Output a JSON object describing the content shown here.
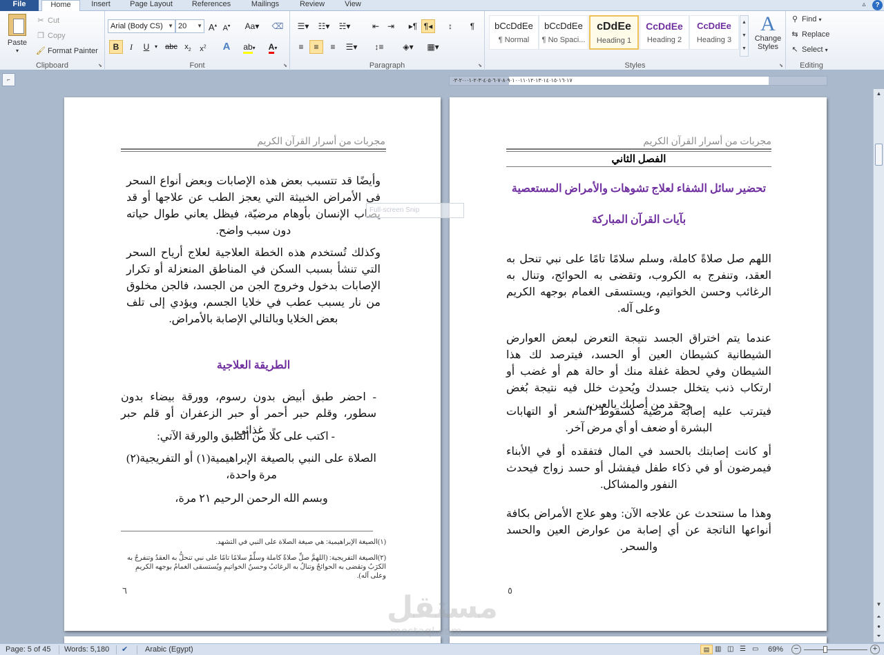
{
  "tabs": {
    "file": "File",
    "home": "Home",
    "insert": "Insert",
    "page_layout": "Page Layout",
    "references": "References",
    "mailings": "Mailings",
    "review": "Review",
    "view": "View"
  },
  "clipboard": {
    "paste": "Paste",
    "cut": "Cut",
    "copy": "Copy",
    "format_painter": "Format Painter",
    "label": "Clipboard"
  },
  "font": {
    "name": "Arial (Body CS)",
    "size": "20",
    "label": "Font"
  },
  "paragraph": {
    "label": "Paragraph"
  },
  "styles": {
    "items": [
      {
        "preview": "bCcDdEe",
        "name": "¶ Normal"
      },
      {
        "preview": "bCcDdEe",
        "name": "¶ No Spaci..."
      },
      {
        "preview": "cDdEe",
        "name": "Heading 1"
      },
      {
        "preview": "CcDdEe",
        "name": "Heading 2"
      },
      {
        "preview": "CcDdEe",
        "name": "Heading 3"
      }
    ],
    "change_styles": "Change Styles",
    "label": "Styles",
    "selected_index": 2
  },
  "editing": {
    "find": "Find",
    "replace": "Replace",
    "select": "Select",
    "label": "Editing"
  },
  "ruler": {
    "text": "·١٧·١٦·١٥·١٤·١٣·١٢·١١·١٠·٩·٨·٧·٦·٥·٤·٣·٢·١·٠·٢·٣"
  },
  "left_page": {
    "header": "مجربات من أسرار القرآن الكريم",
    "paragraphs": [
      "وأيضًا قد تتسبب بعض هذه الإصابات وبعض أنواع السحر في الأمراض الخبيثة التي يعجز الطب عن علاجها أو قد يصاب الإنسان بأوهام مرضيّة، فيظل يعاني طوال حياته دون سبب واضح.",
      "وكذلك تُستخدم هذه الخطة العلاجية لعلاج أرياح السحر التي تنشأ بسبب السكن في المناطق المنعزلة أو تكرار الإصابات بدخول وخروج الجن من الجسد، فالجن مخلوق من نار يسبب عطب في خلايا الجسم، ويؤدي إلى تلف بعض الخلايا وبالتالي الإصابة بالأمراض."
    ],
    "section_heading": "الطريقة العلاجية",
    "steps": [
      "- احضر طبق أبيض بدون رسوم، وورقة بيضاء بدون سطور، وقلم حبر أحمر أو حبر الزعفران أو قلم حبر غذائي.",
      "- اكتب على كلًا من الطبق والورقة الآتي:",
      "الصلاة على النبي بالصيغة الإبراهيمية(١) أو التفريجية(٢) مرة واحدة،",
      "وبسم الله الرحمن الرحيم ٢١ مرة،"
    ],
    "footnotes": [
      "(١)الصيغة الإبراهيمية: هي صيغة الصلاة على النبي في التشهد.",
      "(٢)الصيغة التفريجية: (اللهمَّ صلِّ صلاةً كاملة وسلِّمْ سلامًا تامًا على نبي تنحلُّ به العقدُ وتنفرجُ به الكرَبُ وتقضى به الحوائجُ وتنالُ به الرغائبُ وحسنُ الخواتيمِ ويُستسقى الغمامُ بوجهه الكريمِ وعلى آله)."
    ],
    "page_number": "٦"
  },
  "right_page": {
    "header": "مجربات من أسرار القرآن الكريم",
    "chapter": "الفصل الثاني",
    "title_line1": "تحضير سائل الشفاء لعلاج تشوهات والأمراض المستعصية",
    "title_line2": "بآيات القرآن المباركة",
    "paragraphs": [
      "اللهم صل صلاةً كاملة، وسلم سلامًا تامًا على نبي تنحل به العقد، وتنفرج به الكروب، وتقضى به الحوائج، وتنال به الرغائب وحسن الخواتيم، ويستسقى الغمام بوجهه الكريم وعلى آله.",
      "عندما يتم اختراق الجسد نتيجة التعرض لبعض العوارض الشيطانية كشيطان العين أو الحسد، فيترصد لك هذا الشيطان وفي لحظة غفلة منك أو حالة هم أو غضب أو ارتكاب ذنب يتخلل جسدك ويُحدِث خلل فيه نتيجة بُغض وحقد من أصابك بالعين،",
      "فيترتب عليه إصابة مرضية كسقوط الشعر أو التهابات البشرة أو ضعف أو أي مرض آخر.",
      "أو كانت إصابتك بالحسد في المال فتفقده أو في الأبناء فيمرضون أو في ذكاء طفل فيفشل أو حسد زواج فيحدث النفور والمشاكل.",
      "وهذا ما سنتحدث عن علاجه الآن: وهو علاج الأمراض بكافة أنواعها الناتجة عن أي إصابة من عوارض العين والحسد والسحر."
    ],
    "page_number": "٥"
  },
  "snip_overlay": "Full-screen Snip",
  "watermark": {
    "arabic": "مستقل",
    "latin": "mostaql.com"
  },
  "status": {
    "page": "Page: 5 of 45",
    "words": "Words: 5,180",
    "language": "Arabic (Egypt)",
    "zoom": "69%"
  }
}
